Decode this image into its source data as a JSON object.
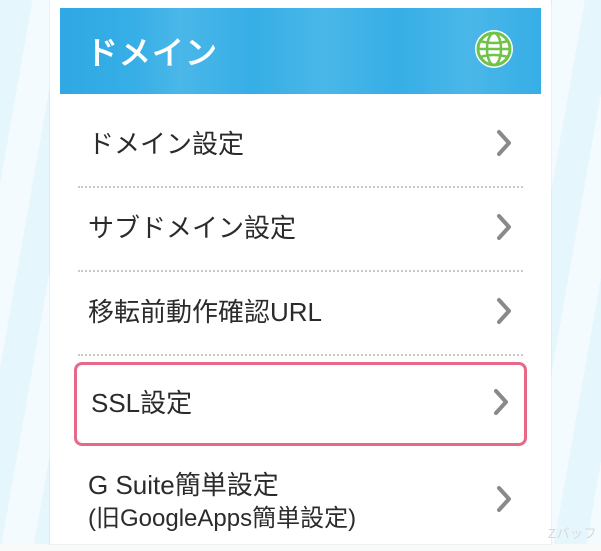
{
  "header": {
    "title": "ドメイン",
    "icon": "globe-icon"
  },
  "menu": {
    "items": [
      {
        "label": "ドメイン設定",
        "sub": ""
      },
      {
        "label": "サブドメイン設定",
        "sub": ""
      },
      {
        "label": "移転前動作確認URL",
        "sub": ""
      },
      {
        "label": "SSL設定",
        "sub": "",
        "highlight": true
      },
      {
        "label": "G Suite簡単設定",
        "sub": "(旧GoogleApps簡単設定)"
      }
    ]
  },
  "watermark": "Zバッフ"
}
